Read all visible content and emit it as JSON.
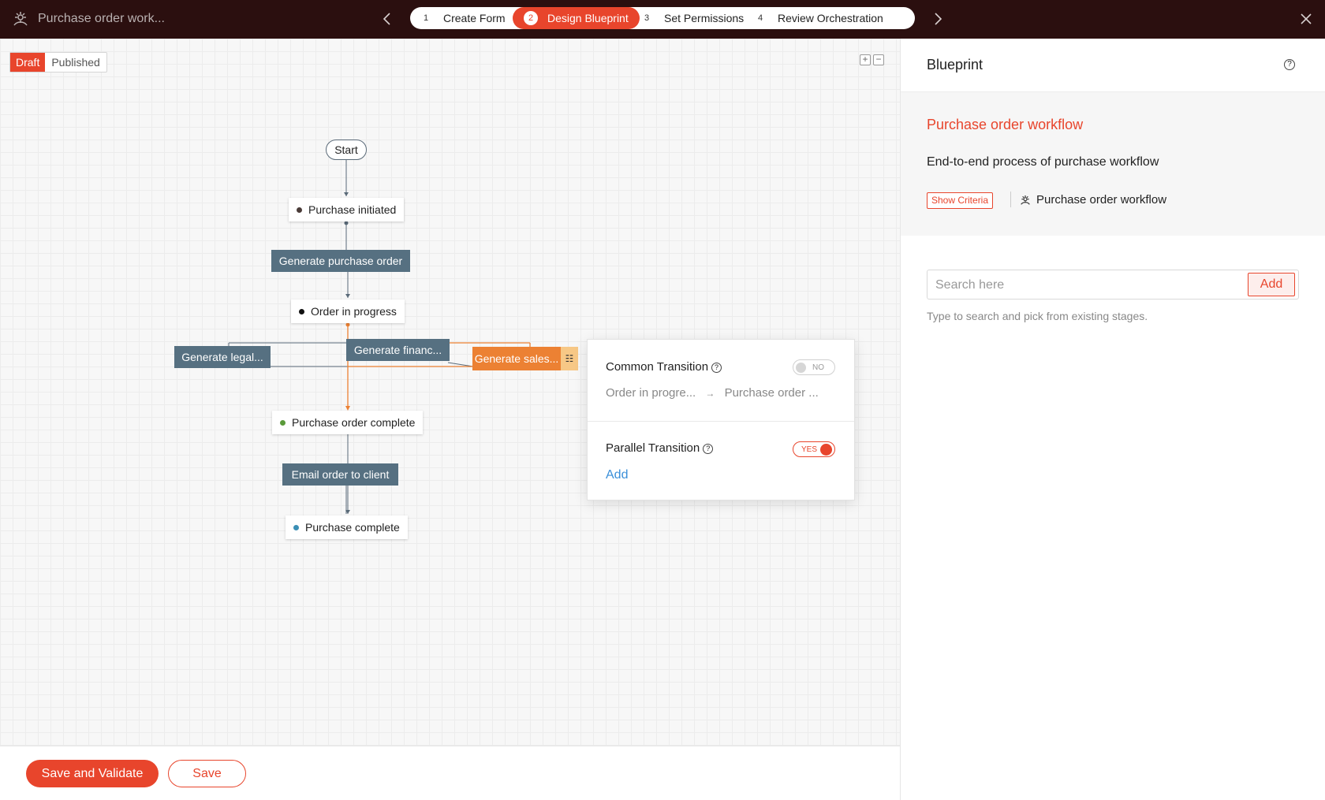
{
  "topbar": {
    "app_title": "Purchase order work...",
    "steps": [
      {
        "num": "1",
        "label": "Create Form"
      },
      {
        "num": "2",
        "label": "Design Blueprint"
      },
      {
        "num": "3",
        "label": "Set Permissions"
      },
      {
        "num": "4",
        "label": "Review Orchestration"
      }
    ],
    "active_step": 2
  },
  "canvas": {
    "status": {
      "draft": "Draft",
      "published": "Published",
      "selected": "Draft"
    },
    "zoom": {
      "in": "+",
      "out": "−"
    },
    "start_label": "Start",
    "states": [
      {
        "label": "Purchase initiated",
        "dot_color": "#4a3b38"
      },
      {
        "label": "Order in progress",
        "dot_color": "#111111"
      },
      {
        "label": "Purchase order complete",
        "dot_color": "#5a9a3a"
      },
      {
        "label": "Purchase complete",
        "dot_color": "#3b8fb5"
      }
    ],
    "transitions": [
      {
        "label": "Generate purchase order"
      },
      {
        "label": "Generate legal..."
      },
      {
        "label": "Generate financ..."
      },
      {
        "label": "Generate sales..."
      },
      {
        "label": "Email order to client"
      }
    ],
    "colors": {
      "transition": "#567081",
      "selected_transition": "#ec8133",
      "edge": "#5a6a78",
      "active_edge": "#ec8133"
    }
  },
  "popover": {
    "common_title": "Common Transition",
    "common_toggle": "NO",
    "path_from": "Order in progre...",
    "path_arrow": "→",
    "path_to": "Purchase order ...",
    "parallel_title": "Parallel Transition",
    "parallel_toggle": "YES",
    "add_link": "Add"
  },
  "footer": {
    "save_validate": "Save and Validate",
    "save": "Save"
  },
  "panel": {
    "title": "Blueprint",
    "workflow_name": "Purchase order workflow",
    "description": "End-to-end process of purchase workflow",
    "show_criteria": "Show Criteria",
    "linked_workflow": "Purchase order workflow",
    "search_placeholder": "Search here",
    "add_button": "Add",
    "hint": "Type to search and pick from existing stages."
  },
  "colors": {
    "accent": "#e8452c",
    "topbar": "#2b0f0f",
    "link": "#3a8fd9"
  }
}
